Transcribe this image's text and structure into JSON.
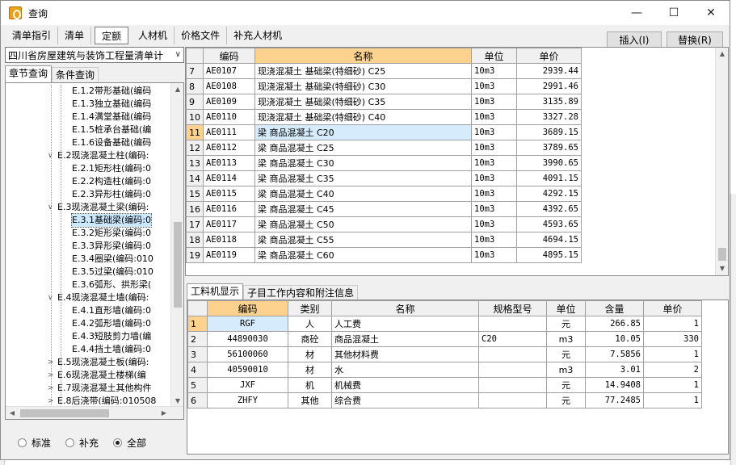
{
  "window": {
    "title": "查询"
  },
  "toolbar": {
    "tabs": [
      "清单指引",
      "清单",
      "定额",
      "人材机",
      "价格文件",
      "补充人材机"
    ],
    "insert_label": "插入(I)",
    "replace_label": "替换(R)"
  },
  "left": {
    "standard": "四川省房屋建筑与装饰工程量清单计",
    "tabs": [
      "章节查询",
      "条件查询"
    ],
    "tree": [
      {
        "text": "E.1.2带形基础(编码",
        "level": 2
      },
      {
        "text": "E.1.3独立基础(编码",
        "level": 2
      },
      {
        "text": "E.1.4满堂基础(编码",
        "level": 2
      },
      {
        "text": "E.1.5桩承台基础(编",
        "level": 2
      },
      {
        "text": "E.1.6设备基础(编码",
        "level": 2
      },
      {
        "text": "E.2现浇混凝土柱(编码:",
        "level": 1
      },
      {
        "text": "E.2.1矩形柱(编码:0",
        "level": 2
      },
      {
        "text": "E.2.2构造柱(编码:0",
        "level": 2
      },
      {
        "text": "E.2.3异形柱(编码:0",
        "level": 2
      },
      {
        "text": "E.3现浇混凝土梁(编码:",
        "level": 1
      },
      {
        "text": "E.3.1基础梁(编码:0",
        "level": 2,
        "selected": true
      },
      {
        "text": "E.3.2矩形梁(编码:0",
        "level": 2
      },
      {
        "text": "E.3.3异形梁(编码:0",
        "level": 2
      },
      {
        "text": "E.3.4圈梁(编码:010",
        "level": 2
      },
      {
        "text": "E.3.5过梁(编码:010",
        "level": 2
      },
      {
        "text": "E.3.6弧形、拱形梁(",
        "level": 2
      },
      {
        "text": "E.4现浇混凝土墙(编码:",
        "level": 1
      },
      {
        "text": "E.4.1直形墙(编码:0",
        "level": 2
      },
      {
        "text": "E.4.2弧形墙(编码:0",
        "level": 2
      },
      {
        "text": "E.4.3短肢剪力墙(编",
        "level": 2
      },
      {
        "text": "E.4.4挡土墙(编码:0",
        "level": 2
      },
      {
        "text": "E.5现浇混凝土板(编码:",
        "level": 1,
        "collapsed": true
      },
      {
        "text": "E.6现浇混凝土楼梯(编",
        "level": 1,
        "collapsed": true
      },
      {
        "text": "E.7现浇混凝土其他构件",
        "level": 1,
        "collapsed": true
      },
      {
        "text": "E.8后浇带(编码:010508",
        "level": 1,
        "collapsed": true
      }
    ],
    "radios": [
      "标准",
      "补充",
      "全部"
    ],
    "radio_checked": 2
  },
  "top_grid": {
    "headers": [
      "",
      "编码",
      "名称",
      "单位",
      "单价"
    ],
    "rows": [
      [
        "7",
        "AE0107",
        "现浇混凝土 基础梁(特细砂) C25",
        "10m3",
        "2939.44"
      ],
      [
        "8",
        "AE0108",
        "现浇混凝土 基础梁(特细砂) C30",
        "10m3",
        "2991.46"
      ],
      [
        "9",
        "AE0109",
        "现浇混凝土 基础梁(特细砂) C35",
        "10m3",
        "3135.89"
      ],
      [
        "10",
        "AE0110",
        "现浇混凝土 基础梁(特细砂) C40",
        "10m3",
        "3327.28"
      ],
      [
        "11",
        "AE0111",
        "梁 商品混凝土 C20",
        "10m3",
        "3689.15"
      ],
      [
        "12",
        "AE0112",
        "梁 商品混凝土 C25",
        "10m3",
        "3789.65"
      ],
      [
        "13",
        "AE0113",
        "梁 商品混凝土 C30",
        "10m3",
        "3990.65"
      ],
      [
        "14",
        "AE0114",
        "梁 商品混凝土 C35",
        "10m3",
        "4091.15"
      ],
      [
        "15",
        "AE0115",
        "梁 商品混凝土 C40",
        "10m3",
        "4292.15"
      ],
      [
        "16",
        "AE0116",
        "梁 商品混凝土 C45",
        "10m3",
        "4392.65"
      ],
      [
        "17",
        "AE0117",
        "梁 商品混凝土 C50",
        "10m3",
        "4593.65"
      ],
      [
        "18",
        "AE0118",
        "梁 商品混凝土 C55",
        "10m3",
        "4694.15"
      ],
      [
        "19",
        "AE0119",
        "梁 商品混凝土 C60",
        "10m3",
        "4895.15"
      ]
    ],
    "selected_index": 4
  },
  "bottom_tabs": [
    "工料机显示",
    "子目工作内容和附注信息"
  ],
  "bottom_grid": {
    "headers": [
      "",
      "编码",
      "类别",
      "名称",
      "规格型号",
      "单位",
      "含量",
      "单价"
    ],
    "rows": [
      [
        "1",
        "RGF",
        "人",
        "人工费",
        "",
        "元",
        "266.85",
        "1"
      ],
      [
        "2",
        "44890030",
        "商砼",
        "商品混凝土",
        "C20",
        "m3",
        "10.05",
        "330"
      ],
      [
        "3",
        "56100060",
        "材",
        "其他材料费",
        "",
        "元",
        "7.5856",
        "1"
      ],
      [
        "4",
        "40590010",
        "材",
        "水",
        "",
        "m3",
        "3.01",
        "2"
      ],
      [
        "5",
        "JXF",
        "机",
        "机械费",
        "",
        "元",
        "14.9408",
        "1"
      ],
      [
        "6",
        "ZHFY",
        "其他",
        "综合费",
        "",
        "元",
        "77.2485",
        "1"
      ]
    ],
    "selected_index": 0
  },
  "colors": {
    "header_highlight": "#fcd28e",
    "selection": "#cce8ff"
  }
}
